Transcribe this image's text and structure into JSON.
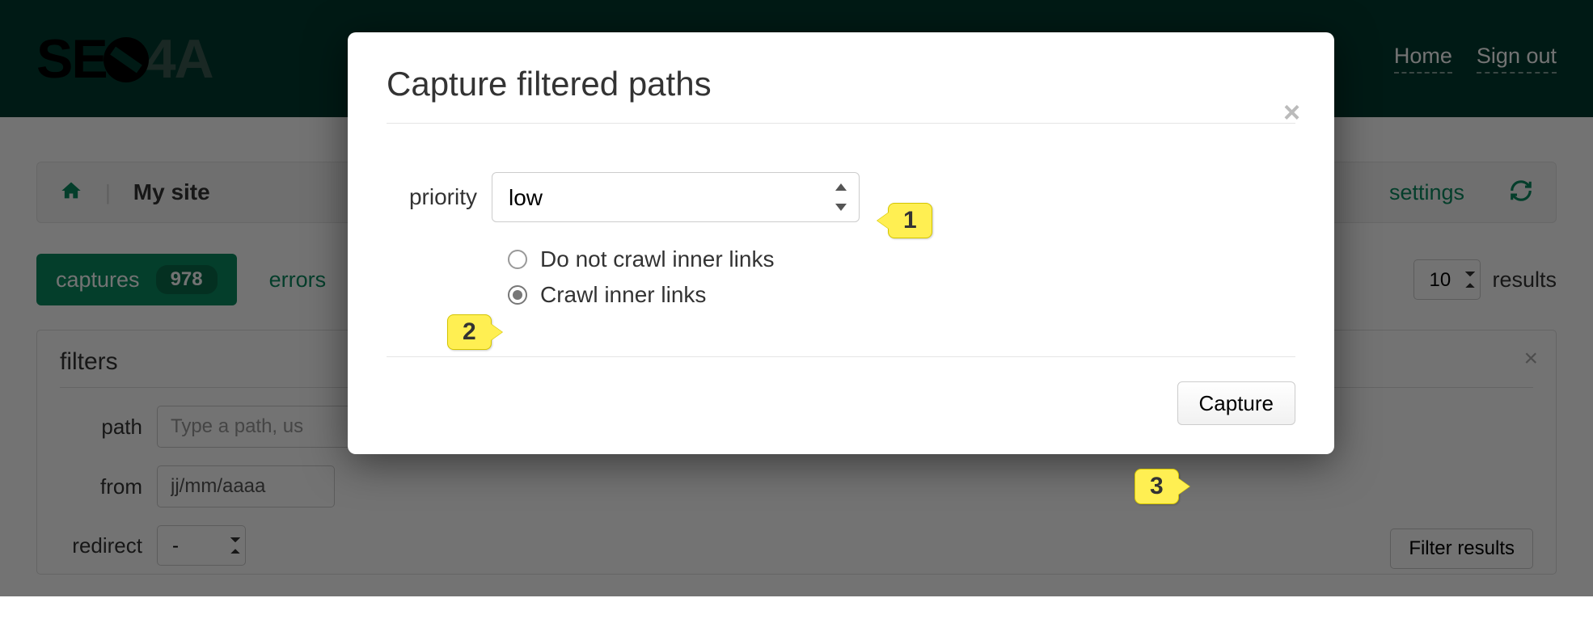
{
  "nav": {
    "home": "Home",
    "signout": "Sign out"
  },
  "breadcrumb": {
    "site": "My site",
    "settings": "settings"
  },
  "tabs": {
    "captures": "captures",
    "captures_count": "978",
    "errors": "errors"
  },
  "results": {
    "page_size": "10",
    "label": "results"
  },
  "filters": {
    "title": "filters",
    "path_label": "path",
    "path_placeholder": "Type a path, us",
    "from_label": "from",
    "from_value": "jj/mm/aaaa",
    "redirect_label": "redirect",
    "redirect_value": "-",
    "button": "Filter results"
  },
  "modal": {
    "title": "Capture filtered paths",
    "priority_label": "priority",
    "priority_value": "low",
    "radio_nocrawl": "Do not crawl inner links",
    "radio_crawl": "Crawl inner links",
    "capture_btn": "Capture"
  },
  "annotations": {
    "n1": "1",
    "n2": "2",
    "n3": "3"
  }
}
